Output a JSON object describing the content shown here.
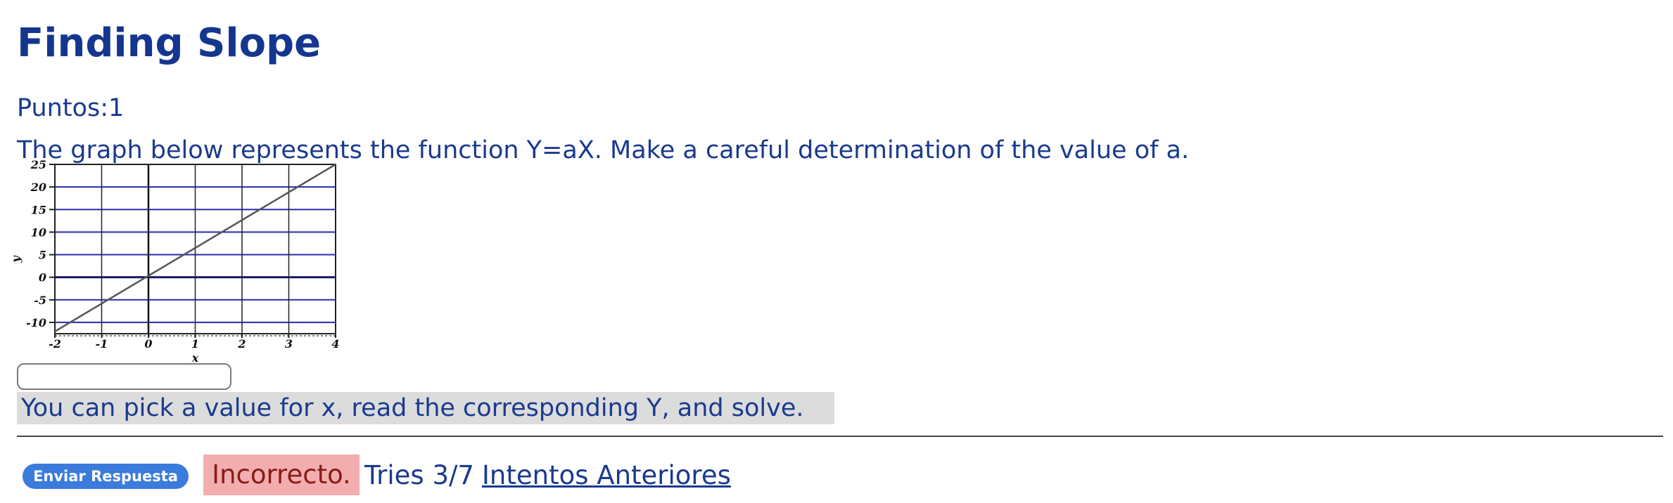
{
  "question": {
    "title": "Finding Slope",
    "points_label": "Puntos:",
    "points_value": "1",
    "prompt": "The graph below represents the function Y=aX. Make a careful determination of the value of a."
  },
  "answer": {
    "value": "",
    "placeholder": ""
  },
  "hint": "You can pick a value for x, read the corresponding Y, and solve.",
  "footer": {
    "submit_label": "Enviar Respuesta",
    "status": "Incorrecto.",
    "tries_label": "Tries 3/7",
    "previous_label": "Intentos Anteriores"
  },
  "colors": {
    "title": "#15368f",
    "text": "#1a3a8f",
    "grid": "#2a2ab0",
    "line": "#555555",
    "button": "#3a7bdb",
    "incorrect_bg": "#f2aeae",
    "hint_bg": "#dcdcdc"
  },
  "chart_data": {
    "type": "line",
    "title": "",
    "xlabel": "x",
    "ylabel": "y",
    "xlim": [
      -2,
      4
    ],
    "ylim": [
      -12,
      25
    ],
    "x_ticks": [
      "-2",
      "-1",
      "0",
      "1",
      "2",
      "3",
      "4"
    ],
    "y_ticks": [
      "25",
      "20",
      "15",
      "10",
      "5",
      "0",
      "-5",
      "-10"
    ],
    "grid": true,
    "series": [
      {
        "x": [
          -2,
          4
        ],
        "y": [
          -12,
          25
        ]
      }
    ]
  }
}
